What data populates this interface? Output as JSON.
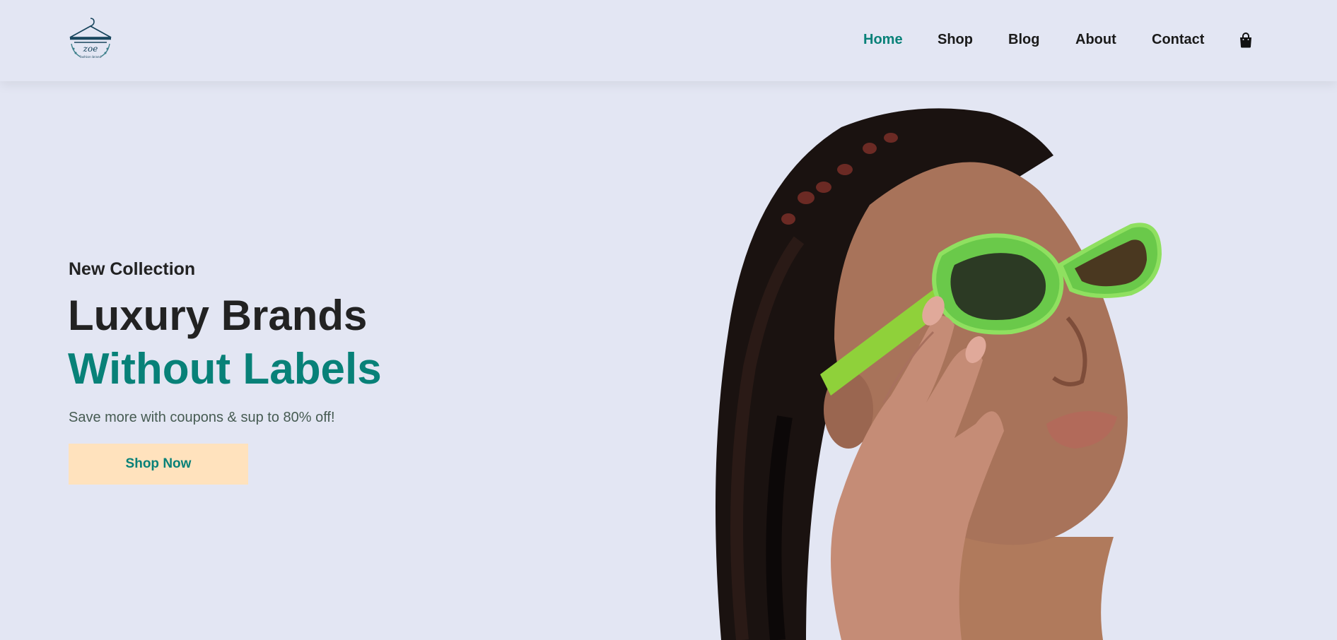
{
  "brand": {
    "logo_text": "zoe",
    "logo_tagline": "fashion brand"
  },
  "nav": {
    "items": [
      {
        "label": "Home",
        "active": true
      },
      {
        "label": "Shop",
        "active": false
      },
      {
        "label": "Blog",
        "active": false
      },
      {
        "label": "About",
        "active": false
      },
      {
        "label": "Contact",
        "active": false
      }
    ],
    "cart_icon": "shopping-bag-icon"
  },
  "hero": {
    "kicker": "New Collection",
    "title_line1": "Luxury Brands",
    "title_line2": "Without Labels",
    "subtitle": "Save more with coupons & sup to 80% off!",
    "cta_label": "Shop Now",
    "image_alt": "woman-with-green-sunglasses-illustration"
  },
  "colors": {
    "background": "#e3e6f3",
    "accent": "#088178",
    "button_bg": "#ffe2bd",
    "heading": "#222222"
  }
}
